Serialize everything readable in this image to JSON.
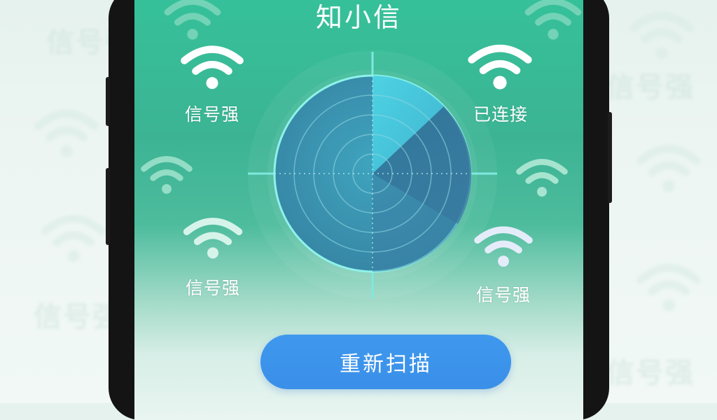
{
  "app": {
    "title": "知小信"
  },
  "networks": [
    {
      "id": "top-left",
      "label": "信号强"
    },
    {
      "id": "top-right",
      "label": "已连接"
    },
    {
      "id": "bottom-left",
      "label": "信号强"
    },
    {
      "id": "bottom-right",
      "label": "信号强"
    }
  ],
  "background": {
    "text": "信号强"
  },
  "actions": {
    "rescan_label": "重新扫描"
  },
  "colors": {
    "accent": "#3a8fe8",
    "screen_top": "#35c29a",
    "radar": "#3d9fb8"
  },
  "icons": {
    "wifi": "wifi-icon"
  }
}
